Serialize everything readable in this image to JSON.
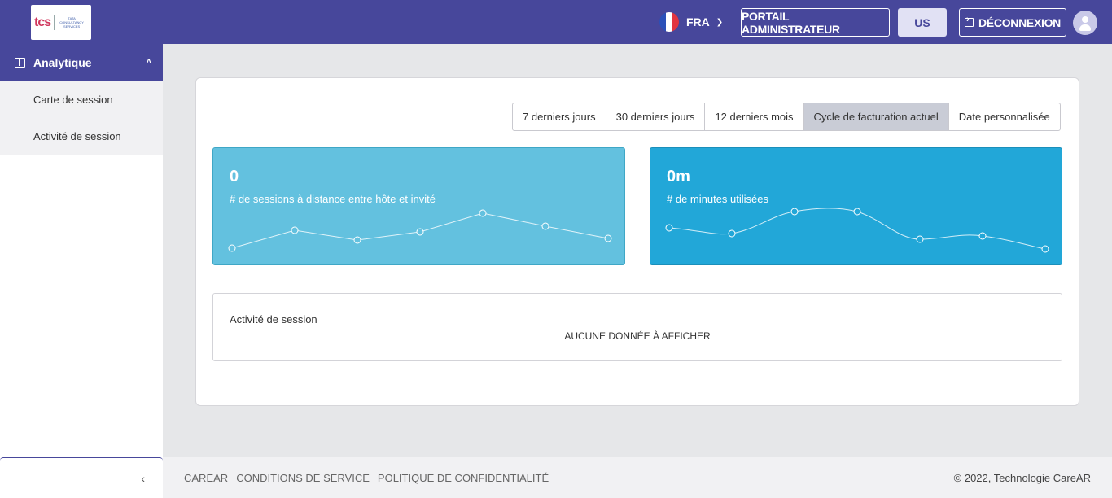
{
  "header": {
    "logo_text": "tcs",
    "logo_sub": "TATA CONSULTANCY SERVICES",
    "language": "FRA",
    "admin_portal": "PORTAIL ADMINISTRATEUR",
    "region": "US",
    "logout": "DÉCONNEXION"
  },
  "sidebar": {
    "section": "Analytique",
    "items": [
      {
        "label": "Carte de session"
      },
      {
        "label": "Activité de session"
      }
    ],
    "collapse": "‹"
  },
  "filters": [
    {
      "label": "7 derniers jours",
      "active": false
    },
    {
      "label": "30 derniers jours",
      "active": false
    },
    {
      "label": "12 derniers mois",
      "active": false
    },
    {
      "label": "Cycle de facturation actuel",
      "active": true
    },
    {
      "label": "Date personnalisée",
      "active": false
    }
  ],
  "stats": [
    {
      "value": "0",
      "label": "# de sessions à distance entre hôte et invité",
      "color": "#63c1df"
    },
    {
      "value": "0m",
      "label": "# de minutes utilisées",
      "color": "#22a7d8"
    }
  ],
  "activity": {
    "title": "Activité de session",
    "empty": "AUCUNE DONNÉE À AFFICHER"
  },
  "footer": {
    "links": [
      "CAREAR",
      "CONDITIONS DE SERVICE",
      "POLITIQUE DE CONFIDENTIALITÉ"
    ],
    "copyright": "© 2022, Technologie CareAR"
  },
  "colors": {
    "brand": "#47479b",
    "accent": "#22a7d8"
  }
}
